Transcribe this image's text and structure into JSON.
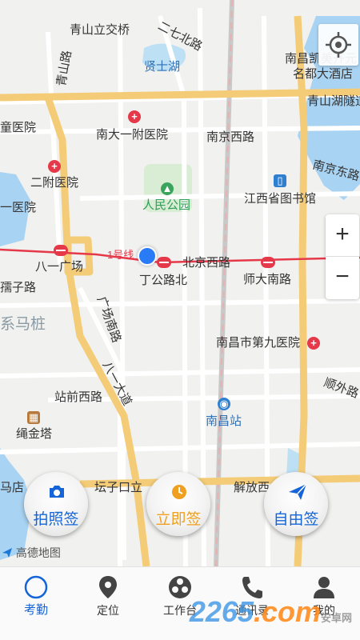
{
  "map": {
    "labels": {
      "qingshan_bridge": "青山立交桥",
      "erqi_n_road": "二七北路",
      "xianshi_lake": "贤士湖",
      "qingshan_road": "青山路",
      "nanchang_hotel_1": "南昌凯美开元",
      "nanchang_hotel_2": "名都大酒店",
      "qingshan_lake": "青山湖隧道",
      "tong_hospital": "童医院",
      "nanda_hospital": "南大一附医院",
      "nanjing_w_road": "南京西路",
      "nanjing_e_road": "南京东路",
      "erfu_hospital": "二附医院",
      "jiangxi_library": "江西省图书馆",
      "ziyi_hospital": "一医院",
      "renmin_park": "人民公园",
      "bayi_square": "八一广场",
      "line1": "1号线",
      "beijing_w_road": "北京西路",
      "dinggong_road": "丁公路北",
      "shida_road": "师大南路",
      "ruzi_road": "孺子路",
      "ximazhuang": "系马桩",
      "guangchang_s_road": "广场南路",
      "ninth_hospital": "南昌市第九医院",
      "bayi_avenue": "八一大道",
      "shunwai_road": "顺外路",
      "zhanqian_road": "站前西路",
      "nanchang_station": "南昌站",
      "shengjin_tower": "绳金塔",
      "mahou": "马店",
      "tanzikou": "坛子口立",
      "jiefang_road": "解放西"
    },
    "zoom_in": "+",
    "zoom_out": "−",
    "attribution": "高德地图"
  },
  "sign_buttons": {
    "photo": "拍照签",
    "now": "立即签",
    "free": "自由签"
  },
  "tabs": [
    {
      "label": "考勤",
      "icon": "attendance-icon"
    },
    {
      "label": "定位",
      "icon": "location-pin-icon"
    },
    {
      "label": "工作台",
      "icon": "workbench-icon"
    },
    {
      "label": "通讯录",
      "icon": "phone-icon"
    },
    {
      "label": "我的",
      "icon": "person-icon"
    }
  ],
  "watermark": {
    "main": "2265",
    "suffix": ".com",
    "small": "安卓网"
  },
  "colors": {
    "accent": "#1565d8",
    "orange": "#f0a020",
    "poi_red": "#e5394a",
    "water": "#a9d3f2"
  }
}
